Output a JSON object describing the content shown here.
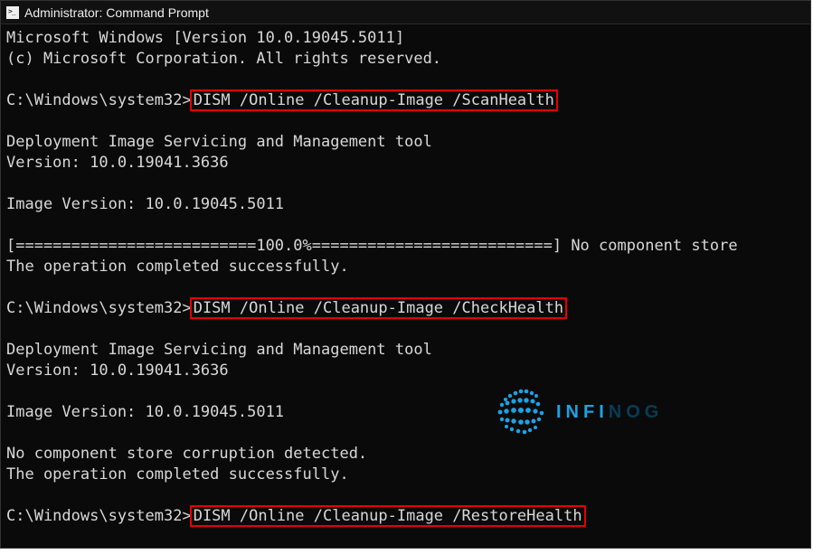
{
  "window": {
    "title": "Administrator: Command Prompt"
  },
  "lines": {
    "ver1": "Microsoft Windows [Version 10.0.19045.5011]",
    "ver2": "(c) Microsoft Corporation. All rights reserved.",
    "prompt1": "C:\\Windows\\system32>",
    "cmd1": "DISM /Online /Cleanup-Image /ScanHealth",
    "dism1": "Deployment Image Servicing and Management tool",
    "dismver1": "Version: 10.0.19041.3636",
    "imgver1": "Image Version: 10.0.19045.5011",
    "progress": "[==========================100.0%==========================] No component store",
    "opdone1": "The operation completed successfully.",
    "prompt2": "C:\\Windows\\system32>",
    "cmd2": "DISM /Online /Cleanup-Image /CheckHealth",
    "dism2": "Deployment Image Servicing and Management tool",
    "dismver2": "Version: 10.0.19041.3636",
    "imgver2": "Image Version: 10.0.19045.5011",
    "nocorrupt": "No component store corruption detected.",
    "opdone2": "The operation completed successfully.",
    "prompt3": "C:\\Windows\\system32>",
    "cmd3": "DISM /Online /Cleanup-Image /RestoreHealth"
  },
  "watermark": {
    "text1": "INFI",
    "text2": "NOG"
  }
}
